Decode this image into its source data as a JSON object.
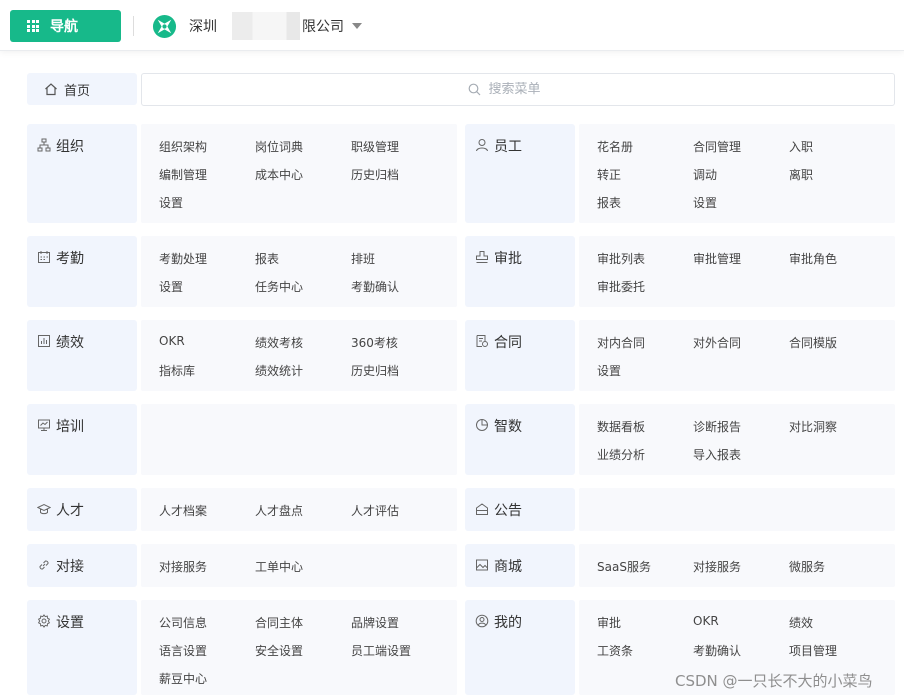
{
  "topbar": {
    "nav_label": "导航",
    "company_prefix": "深圳",
    "company_suffix": "限公司"
  },
  "home_label": "首页",
  "search": {
    "placeholder": "搜索菜单"
  },
  "categories": [
    {
      "name": "组织",
      "icon": "org-icon",
      "items": [
        "组织架构",
        "岗位词典",
        "职级管理",
        "编制管理",
        "成本中心",
        "历史归档",
        "设置"
      ]
    },
    {
      "name": "员工",
      "icon": "user-icon",
      "items": [
        "花名册",
        "合同管理",
        "入职",
        "转正",
        "调动",
        "离职",
        "报表",
        "设置"
      ]
    },
    {
      "name": "考勤",
      "icon": "calendar-icon",
      "items": [
        "考勤处理",
        "报表",
        "排班",
        "设置",
        "任务中心",
        "考勤确认"
      ]
    },
    {
      "name": "审批",
      "icon": "stamp-icon",
      "items": [
        "审批列表",
        "审批管理",
        "审批角色",
        "审批委托"
      ]
    },
    {
      "name": "绩效",
      "icon": "bar-chart-icon",
      "items": [
        "OKR",
        "绩效考核",
        "360考核",
        "指标库",
        "绩效统计",
        "历史归档"
      ]
    },
    {
      "name": "合同",
      "icon": "contract-icon",
      "items": [
        "对内合同",
        "对外合同",
        "合同模版",
        "设置"
      ]
    },
    {
      "name": "培训",
      "icon": "presentation-icon",
      "items": []
    },
    {
      "name": "智数",
      "icon": "pie-chart-icon",
      "items": [
        "数据看板",
        "诊断报告",
        "对比洞察",
        "业绩分析",
        "导入报表"
      ]
    },
    {
      "name": "人才",
      "icon": "graduation-cap-icon",
      "items": [
        "人才档案",
        "人才盘点",
        "人才评估"
      ]
    },
    {
      "name": "公告",
      "icon": "announcement-icon",
      "items": []
    },
    {
      "name": "对接",
      "icon": "link-icon",
      "items": [
        "对接服务",
        "工单中心"
      ]
    },
    {
      "name": "商城",
      "icon": "image-icon",
      "items": [
        "SaaS服务",
        "对接服务",
        "微服务"
      ]
    },
    {
      "name": "设置",
      "icon": "gear-icon",
      "items": [
        "公司信息",
        "合同主体",
        "品牌设置",
        "语言设置",
        "安全设置",
        "员工端设置",
        "薪豆中心"
      ]
    },
    {
      "name": "我的",
      "icon": "profile-icon",
      "items": [
        "审批",
        "OKR",
        "绩效",
        "工资条",
        "考勤确认",
        "项目管理"
      ]
    }
  ],
  "watermark": "CSDN @一只长不大的小菜鸟"
}
